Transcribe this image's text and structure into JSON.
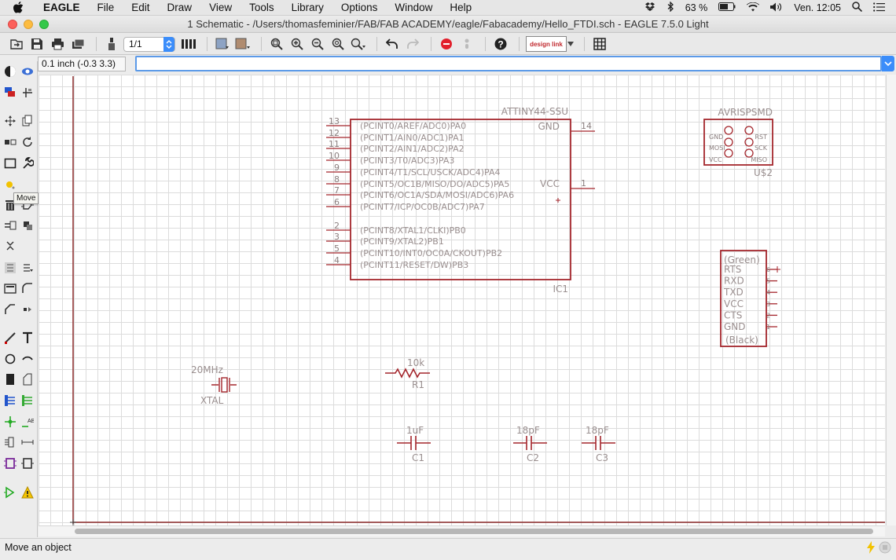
{
  "menubar": {
    "app_name": "EAGLE",
    "items": [
      "File",
      "Edit",
      "Draw",
      "View",
      "Tools",
      "Library",
      "Options",
      "Window",
      "Help"
    ],
    "battery": "63 %",
    "clock": "Ven. 12:05"
  },
  "window": {
    "title": "1 Schematic - /Users/thomasfeminier/FAB/FAB ACADEMY/eagle/Fabacademy/Hello_FTDI.sch - EAGLE 7.5.0 Light"
  },
  "toolbar": {
    "sheet_value": "1/1",
    "design_link_label": "design link"
  },
  "command_row": {
    "coordinate_display": "0.1 inch (-0.3 3.3)",
    "command_value": ""
  },
  "palette": {
    "tooltip": "Move"
  },
  "schematic": {
    "ic1": {
      "device": "ATTINY44-SSU",
      "name": "IC1",
      "left_pins": [
        {
          "num": "13",
          "label": "(PCINT0/AREF/ADC0)PA0"
        },
        {
          "num": "12",
          "label": "(PCINT1/AIN0/ADC1)PA1"
        },
        {
          "num": "11",
          "label": "(PCINT2/AIN1/ADC2)PA2"
        },
        {
          "num": "10",
          "label": "(PCINT3/T0/ADC3)PA3"
        },
        {
          "num": "9",
          "label": "(PCINT4/T1/SCL/USCK/ADC4)PA4"
        },
        {
          "num": "8",
          "label": "(PCINT5/OC1B/MISO/DO/ADC5)PA5"
        },
        {
          "num": "7",
          "label": "(PCINT6/OC1A/SDA/MOSI/ADC6)PA6"
        },
        {
          "num": "6",
          "label": "(PCINT7/ICP/OC0B/ADC7)PA7"
        },
        {
          "num": "2",
          "label": "(PCINT8/XTAL1/CLKI)PB0"
        },
        {
          "num": "3",
          "label": "(PCINT9/XTAL2)PB1"
        },
        {
          "num": "5",
          "label": "(PCINT10/INT0/OC0A/CKOUT)PB2"
        },
        {
          "num": "4",
          "label": "(PCINT11/RESET/DW)PB3"
        }
      ],
      "right_pins": [
        {
          "num": "14",
          "label": "GND"
        },
        {
          "num": "1",
          "label": "VCC"
        }
      ]
    },
    "avrisp": {
      "device": "AVRISPSMD",
      "name": "U$2",
      "left_labels": [
        "GND",
        "MOSI",
        "VCC"
      ],
      "right_labels": [
        "RST",
        "SCK",
        "MISO"
      ]
    },
    "ftdi": {
      "top_label": "(Green)",
      "bottom_label": "(Black)",
      "pins": [
        {
          "label": "RTS",
          "num": "6"
        },
        {
          "label": "RXD",
          "num": "5"
        },
        {
          "label": "TXD",
          "num": "4"
        },
        {
          "label": "VCC",
          "num": "3"
        },
        {
          "label": "CTS",
          "num": "2"
        },
        {
          "label": "GND",
          "num": "1"
        }
      ]
    },
    "xtal": {
      "value": "20MHz",
      "name": "XTAL"
    },
    "r1": {
      "value": "10k",
      "name": "R1"
    },
    "c1": {
      "value": "1uF",
      "name": "C1"
    },
    "c2": {
      "value": "18pF",
      "name": "C2"
    },
    "c3": {
      "value": "18pF",
      "name": "C3"
    }
  },
  "statusbar": {
    "message": "Move an object"
  },
  "colors": {
    "symbol": "#a4262c",
    "label": "#9a8f8f",
    "frame": "#8b2a2a",
    "grid": "#dcdcdc",
    "accent": "#3b8dfa"
  }
}
